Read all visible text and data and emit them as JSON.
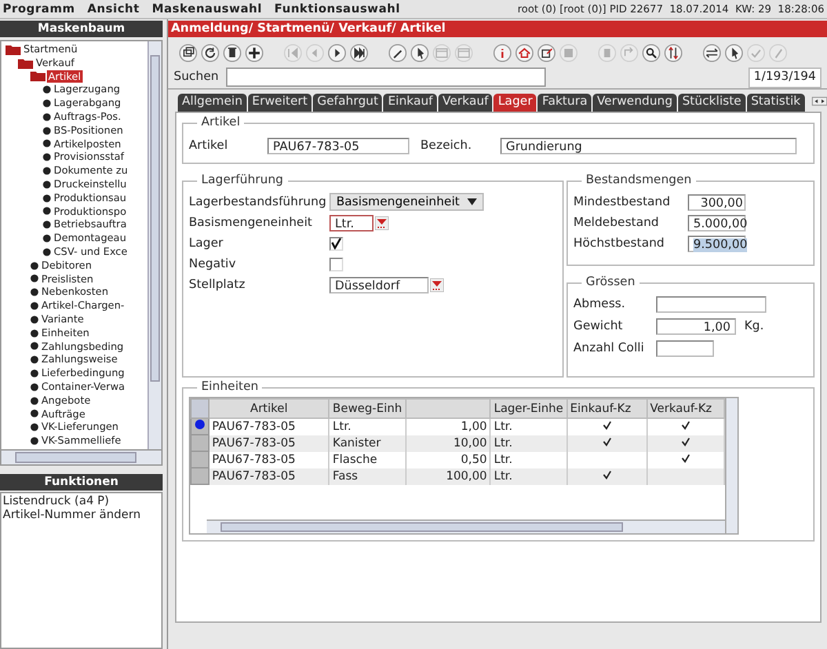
{
  "menu": [
    "Programm",
    "Ansicht",
    "Maskenauswahl",
    "Funktionsauswahl"
  ],
  "status": "root (0) [root (0)] PID 22677  18.07.2014  KW: 29  18:28:06",
  "sidebar": {
    "title": "Maskenbaum",
    "tree": [
      {
        "label": "Startmenü",
        "kind": "folder",
        "selected": false,
        "children": [
          {
            "label": "Verkauf",
            "kind": "folder",
            "selected": false,
            "children": [
              {
                "label": "Artikel",
                "kind": "folder",
                "selected": true,
                "children": [
                  {
                    "label": "Lagerzugang",
                    "kind": "leaf",
                    "selected": false
                  },
                  {
                    "label": "Lagerabgang",
                    "kind": "leaf",
                    "selected": false
                  },
                  {
                    "label": "Auftrags-Pos.",
                    "kind": "leaf",
                    "selected": false
                  },
                  {
                    "label": "BS-Positionen",
                    "kind": "leaf",
                    "selected": false
                  },
                  {
                    "label": "Artikelposten",
                    "kind": "leaf",
                    "selected": false
                  },
                  {
                    "label": "Provisionsstaf",
                    "kind": "leaf",
                    "selected": false
                  },
                  {
                    "label": "Dokumente zu",
                    "kind": "leaf",
                    "selected": false
                  },
                  {
                    "label": "Druckeinstellu",
                    "kind": "leaf",
                    "selected": false
                  },
                  {
                    "label": "Produktionsau",
                    "kind": "leaf",
                    "selected": false
                  },
                  {
                    "label": "Produktionspo",
                    "kind": "leaf",
                    "selected": false
                  },
                  {
                    "label": "Betriebsauftra",
                    "kind": "leaf",
                    "selected": false
                  },
                  {
                    "label": "Demontageau",
                    "kind": "leaf",
                    "selected": false
                  },
                  {
                    "label": "CSV- und Exce",
                    "kind": "leaf",
                    "selected": false
                  }
                ]
              },
              {
                "label": "Debitoren",
                "kind": "leaf",
                "selected": false
              },
              {
                "label": "Preislisten",
                "kind": "leaf",
                "selected": false
              },
              {
                "label": "Nebenkosten",
                "kind": "leaf",
                "selected": false
              },
              {
                "label": "Artikel-Chargen-",
                "kind": "leaf",
                "selected": false
              },
              {
                "label": "Variante",
                "kind": "leaf",
                "selected": false
              },
              {
                "label": "Einheiten",
                "kind": "leaf",
                "selected": false
              },
              {
                "label": "Zahlungsbeding",
                "kind": "leaf",
                "selected": false
              },
              {
                "label": "Zahlungsweise",
                "kind": "leaf",
                "selected": false
              },
              {
                "label": "Lieferbedingung",
                "kind": "leaf",
                "selected": false
              },
              {
                "label": "Container-Verwa",
                "kind": "leaf",
                "selected": false
              },
              {
                "label": "Angebote",
                "kind": "leaf",
                "selected": false
              },
              {
                "label": "Aufträge",
                "kind": "leaf",
                "selected": false
              },
              {
                "label": "VK-Lieferungen",
                "kind": "leaf",
                "selected": false
              },
              {
                "label": "VK-Sammelliefe",
                "kind": "leaf",
                "selected": false
              }
            ]
          }
        ]
      }
    ]
  },
  "functions": {
    "title": "Funktionen",
    "items": [
      "Listendruck (a4 P)",
      "Artikel-Nummer ändern"
    ]
  },
  "breadcrumb": "Anmeldung/ Startmenü/ Verkauf/ Artikel",
  "toolbar": [
    {
      "kind": "copy",
      "disabled": false
    },
    {
      "kind": "refresh",
      "disabled": false
    },
    {
      "kind": "delete",
      "disabled": false
    },
    {
      "kind": "add",
      "disabled": false
    },
    {
      "kind": "gap"
    },
    {
      "kind": "first",
      "disabled": true
    },
    {
      "kind": "prev",
      "disabled": true
    },
    {
      "kind": "next",
      "disabled": false
    },
    {
      "kind": "last",
      "disabled": false
    },
    {
      "kind": "gap"
    },
    {
      "kind": "edit",
      "disabled": false
    },
    {
      "kind": "pointer",
      "disabled": false
    },
    {
      "kind": "window",
      "disabled": true
    },
    {
      "kind": "window",
      "disabled": true
    },
    {
      "kind": "gap"
    },
    {
      "kind": "info",
      "disabled": false
    },
    {
      "kind": "home",
      "disabled": false
    },
    {
      "kind": "export",
      "disabled": false
    },
    {
      "kind": "save",
      "disabled": true
    },
    {
      "kind": "gap"
    },
    {
      "kind": "trash",
      "disabled": true
    },
    {
      "kind": "up",
      "disabled": true
    },
    {
      "kind": "search",
      "disabled": false
    },
    {
      "kind": "sort",
      "disabled": false
    },
    {
      "kind": "gap"
    },
    {
      "kind": "swap",
      "disabled": false
    },
    {
      "kind": "pointer",
      "disabled": false
    },
    {
      "kind": "check",
      "disabled": true
    },
    {
      "kind": "pen",
      "disabled": true
    }
  ],
  "search": {
    "label": "Suchen",
    "counter": "1/193/194"
  },
  "tabs": [
    {
      "label": "Allgemein",
      "selected": false
    },
    {
      "label": "Erweitert",
      "selected": false
    },
    {
      "label": "Gefahrgut",
      "selected": false
    },
    {
      "label": "Einkauf",
      "selected": false
    },
    {
      "label": "Verkauf",
      "selected": false
    },
    {
      "label": "Lager",
      "selected": true
    },
    {
      "label": "Faktura",
      "selected": false
    },
    {
      "label": "Verwendung",
      "selected": false
    },
    {
      "label": "Stückliste",
      "selected": false
    },
    {
      "label": "Statistik",
      "selected": false
    }
  ],
  "artikel_group": {
    "title": "Artikel",
    "fields": [
      {
        "label": "Artikel",
        "value": "PAU67-783-05"
      },
      {
        "label": "Bezeich.",
        "value": "Grundierung"
      }
    ]
  },
  "lagerfuehrung": {
    "title": "Lagerführung",
    "fields": [
      {
        "label": "Lagerbestandsführung",
        "kind": "dropdown",
        "value": "Basismengeneinheit"
      },
      {
        "label": "Basismengeneinheit",
        "kind": "lookup",
        "value": "Ltr."
      },
      {
        "label": "Lager",
        "kind": "checkbox",
        "checked": true
      },
      {
        "label": "Negativ",
        "kind": "checkbox",
        "checked": false
      },
      {
        "label": "Stellplatz",
        "kind": "lookup",
        "value": "Düsseldorf"
      }
    ]
  },
  "bestandsmengen": {
    "title": "Bestandsmengen",
    "fields": [
      {
        "label": "Mindestbestand",
        "value": "300,00",
        "selected": false
      },
      {
        "label": "Meldebestand",
        "value": "5.000,00",
        "selected": false
      },
      {
        "label": "Höchstbestand",
        "value": "9.500,00",
        "selected": true
      }
    ]
  },
  "groessen": {
    "title": "Grössen",
    "fields": [
      {
        "label": "Abmess."
      },
      {
        "label": "Gewicht",
        "value": "1,00",
        "unit": "Kg."
      },
      {
        "label": "Anzahl Colli"
      }
    ]
  },
  "einheiten": {
    "title": "Einheiten",
    "columns": [
      {
        "label": "Artikel"
      },
      {
        "label": "Beweg-Einh"
      },
      {},
      {
        "label": "Lager-Einhe"
      },
      {
        "label": "Einkauf-Kz"
      },
      {
        "label": "Verkauf-Kz"
      }
    ],
    "rows": [
      {
        "selected": true,
        "artikel": "PAU67-783-05",
        "beweg_einh": "Ltr.",
        "column_3": "1,00",
        "lager_einhe": "Ltr.",
        "einkauf_kz": true,
        "verkauf_kz": true
      },
      {
        "selected": false,
        "artikel": "PAU67-783-05",
        "beweg_einh": "Kanister",
        "column_3": "10,00",
        "lager_einhe": "Ltr.",
        "einkauf_kz": true,
        "verkauf_kz": true
      },
      {
        "selected": false,
        "artikel": "PAU67-783-05",
        "beweg_einh": "Flasche",
        "column_3": "0,50",
        "lager_einhe": "Ltr.",
        "einkauf_kz": false,
        "verkauf_kz": true
      },
      {
        "selected": false,
        "artikel": "PAU67-783-05",
        "beweg_einh": "Fass",
        "column_3": "100,00",
        "lager_einhe": "Ltr.",
        "einkauf_kz": true,
        "verkauf_kz": false
      }
    ]
  }
}
